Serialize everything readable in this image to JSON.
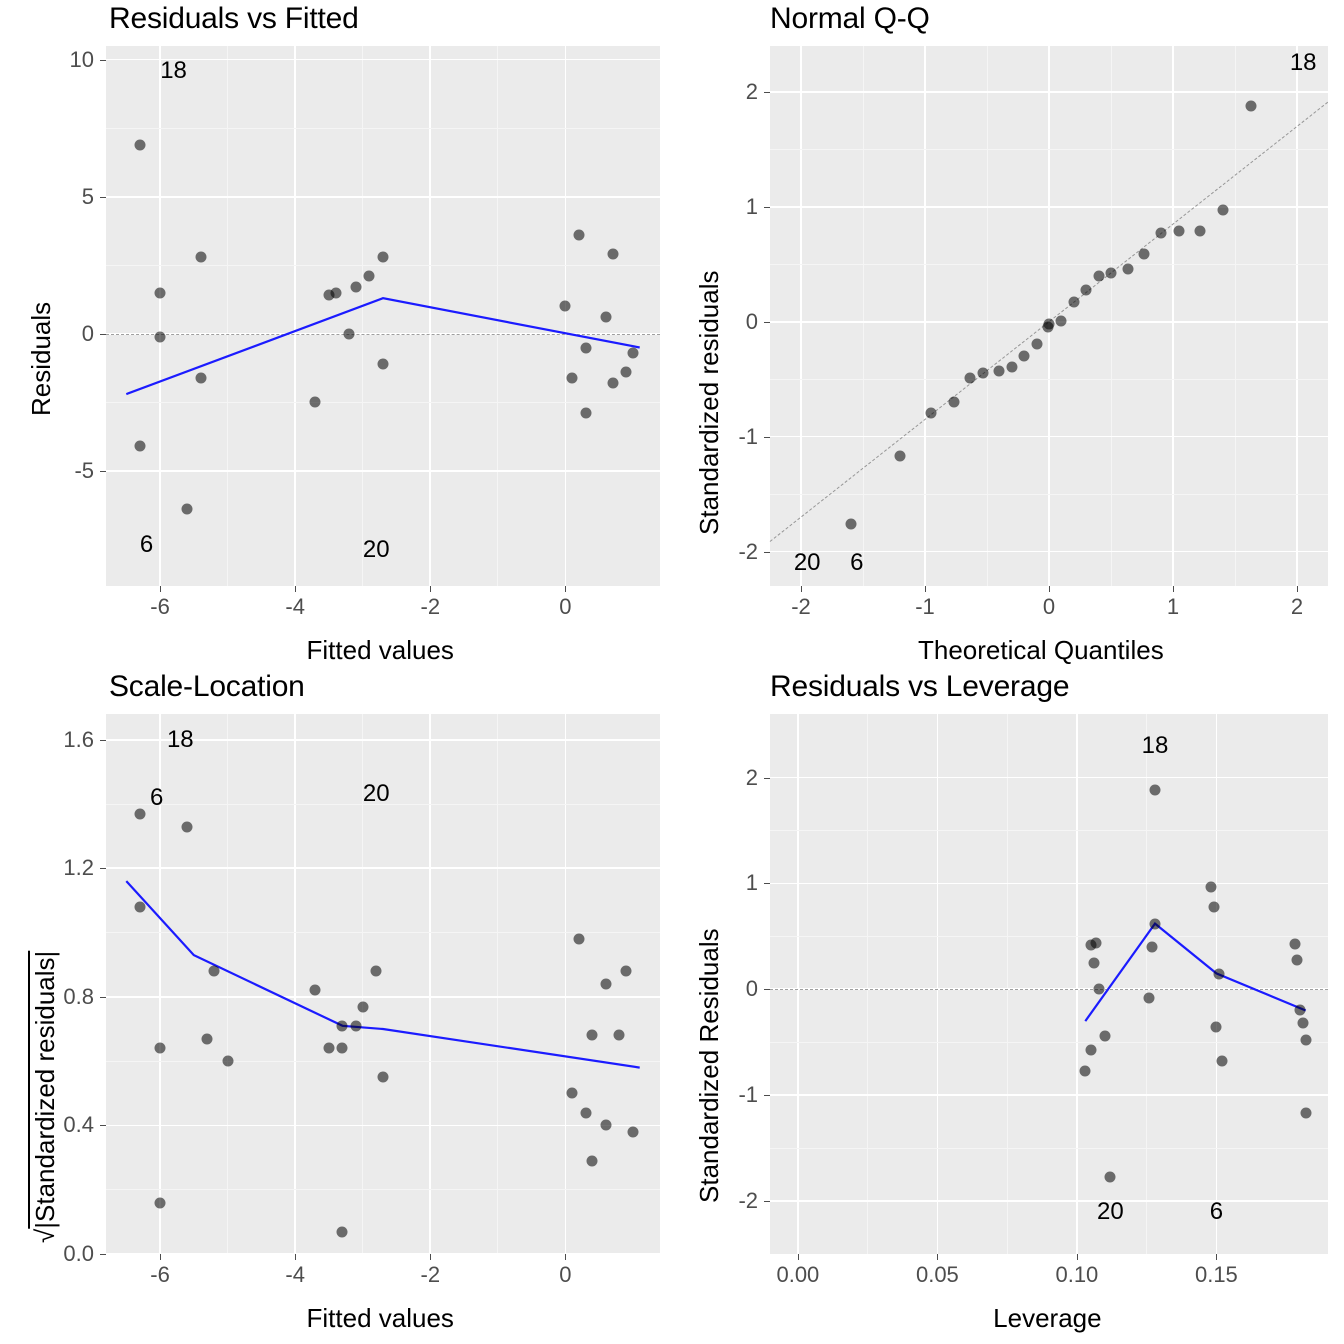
{
  "chart_data": [
    {
      "id": "resid_fitted",
      "type": "scatter",
      "title": "Residuals vs Fitted",
      "xlabel": "Fitted values",
      "ylabel": "Residuals",
      "xlim": [
        -6.8,
        1.4
      ],
      "ylim": [
        -9.2,
        10.5
      ],
      "x_ticks": [
        -6,
        -4,
        -2,
        0
      ],
      "y_ticks": [
        -5,
        0,
        5,
        10
      ],
      "hline": 0,
      "points": [
        {
          "x": -6.3,
          "y": -4.1
        },
        {
          "x": -6.3,
          "y": 6.9
        },
        {
          "x": -6.0,
          "y": -0.1
        },
        {
          "x": -6.0,
          "y": 1.5
        },
        {
          "x": -5.6,
          "y": -6.4
        },
        {
          "x": -5.4,
          "y": -1.6
        },
        {
          "x": -5.4,
          "y": 2.8
        },
        {
          "x": -3.7,
          "y": -2.5
        },
        {
          "x": -3.5,
          "y": 1.4
        },
        {
          "x": -3.4,
          "y": 1.5
        },
        {
          "x": -3.2,
          "y": 0.0
        },
        {
          "x": -3.1,
          "y": 1.7
        },
        {
          "x": -2.9,
          "y": 2.1
        },
        {
          "x": -2.7,
          "y": 2.8
        },
        {
          "x": -2.7,
          "y": -1.1
        },
        {
          "x": 0.0,
          "y": 1.0
        },
        {
          "x": 0.1,
          "y": -1.6
        },
        {
          "x": 0.2,
          "y": 3.6
        },
        {
          "x": 0.3,
          "y": -0.5
        },
        {
          "x": 0.3,
          "y": -2.9
        },
        {
          "x": 0.6,
          "y": 0.6
        },
        {
          "x": 0.7,
          "y": -1.8
        },
        {
          "x": 0.7,
          "y": 2.9
        },
        {
          "x": 0.9,
          "y": -1.4
        },
        {
          "x": 1.0,
          "y": -0.7
        }
      ],
      "smooth": [
        {
          "x": -6.5,
          "y": -2.2
        },
        {
          "x": -2.7,
          "y": 1.3
        },
        {
          "x": 1.1,
          "y": -0.5
        }
      ],
      "annotations": [
        {
          "x": -5.8,
          "y": 9.6,
          "text": "18"
        },
        {
          "x": -6.2,
          "y": -7.7,
          "text": "6"
        },
        {
          "x": -2.8,
          "y": -7.9,
          "text": "20"
        }
      ]
    },
    {
      "id": "qq",
      "type": "scatter",
      "title": "Normal Q-Q",
      "xlabel": "Theoretical Quantiles",
      "ylabel": "Standardized residuals",
      "xlim": [
        -2.25,
        2.25
      ],
      "ylim": [
        -2.3,
        2.4
      ],
      "x_ticks": [
        -2,
        -1,
        0,
        1,
        2
      ],
      "y_ticks": [
        -2,
        -1,
        0,
        1,
        2
      ],
      "refline": {
        "slope": 0.85,
        "intercept": 0.0
      },
      "points": [
        {
          "x": -1.6,
          "y": -1.76
        },
        {
          "x": -1.2,
          "y": -1.17
        },
        {
          "x": -0.95,
          "y": -0.79
        },
        {
          "x": -0.77,
          "y": -0.7
        },
        {
          "x": -0.64,
          "y": -0.49
        },
        {
          "x": -0.53,
          "y": -0.45
        },
        {
          "x": -0.4,
          "y": -0.43
        },
        {
          "x": -0.3,
          "y": -0.39
        },
        {
          "x": -0.2,
          "y": -0.3
        },
        {
          "x": -0.1,
          "y": -0.19
        },
        {
          "x": -0.01,
          "y": -0.05
        },
        {
          "x": 0.0,
          "y": -0.02
        },
        {
          "x": 0.1,
          "y": 0.01
        },
        {
          "x": 0.2,
          "y": 0.17
        },
        {
          "x": 0.3,
          "y": 0.28
        },
        {
          "x": 0.4,
          "y": 0.4
        },
        {
          "x": 0.5,
          "y": 0.42
        },
        {
          "x": 0.64,
          "y": 0.46
        },
        {
          "x": 0.77,
          "y": 0.59
        },
        {
          "x": 0.9,
          "y": 0.77
        },
        {
          "x": 1.05,
          "y": 0.79
        },
        {
          "x": 1.22,
          "y": 0.79
        },
        {
          "x": 1.4,
          "y": 0.97
        },
        {
          "x": 1.63,
          "y": 1.88
        }
      ],
      "annotations": [
        {
          "x": 2.05,
          "y": 2.25,
          "text": "18"
        },
        {
          "x": -1.95,
          "y": -2.1,
          "text": "20"
        },
        {
          "x": -1.55,
          "y": -2.1,
          "text": "6"
        }
      ]
    },
    {
      "id": "scale_loc",
      "type": "scatter",
      "title": "Scale-Location",
      "xlabel": "Fitted values",
      "ylabel_complex": {
        "prefix": "√",
        "body": "|Standardized residuals|"
      },
      "xlim": [
        -6.8,
        1.4
      ],
      "ylim": [
        0.0,
        1.68
      ],
      "x_ticks": [
        -6,
        -4,
        -2,
        0
      ],
      "y_ticks": [
        0.0,
        0.4,
        0.8,
        1.2,
        1.6
      ],
      "points": [
        {
          "x": -6.3,
          "y": 1.08
        },
        {
          "x": -6.3,
          "y": 1.37
        },
        {
          "x": -6.0,
          "y": 0.16
        },
        {
          "x": -6.0,
          "y": 0.64
        },
        {
          "x": -5.6,
          "y": 1.33
        },
        {
          "x": -5.3,
          "y": 0.67
        },
        {
          "x": -5.2,
          "y": 0.88
        },
        {
          "x": -5.0,
          "y": 0.6
        },
        {
          "x": -3.7,
          "y": 0.82
        },
        {
          "x": -3.5,
          "y": 0.64
        },
        {
          "x": -3.3,
          "y": 0.07
        },
        {
          "x": -3.3,
          "y": 0.64
        },
        {
          "x": -3.3,
          "y": 0.71
        },
        {
          "x": -3.1,
          "y": 0.71
        },
        {
          "x": -3.0,
          "y": 0.77
        },
        {
          "x": -2.8,
          "y": 0.88
        },
        {
          "x": -2.7,
          "y": 0.55
        },
        {
          "x": 0.1,
          "y": 0.5
        },
        {
          "x": 0.2,
          "y": 0.98
        },
        {
          "x": 0.3,
          "y": 0.44
        },
        {
          "x": 0.4,
          "y": 0.68
        },
        {
          "x": 0.4,
          "y": 0.29
        },
        {
          "x": 0.6,
          "y": 0.84
        },
        {
          "x": 0.6,
          "y": 0.4
        },
        {
          "x": 0.8,
          "y": 0.68
        },
        {
          "x": 0.9,
          "y": 0.88
        },
        {
          "x": 1.0,
          "y": 0.38
        }
      ],
      "smooth": [
        {
          "x": -6.5,
          "y": 1.16
        },
        {
          "x": -5.5,
          "y": 0.93
        },
        {
          "x": -3.3,
          "y": 0.71
        },
        {
          "x": -2.7,
          "y": 0.7
        },
        {
          "x": 1.1,
          "y": 0.58
        }
      ],
      "annotations": [
        {
          "x": -5.7,
          "y": 1.6,
          "text": "18"
        },
        {
          "x": -6.05,
          "y": 1.42,
          "text": "6"
        },
        {
          "x": -2.8,
          "y": 1.43,
          "text": "20"
        }
      ]
    },
    {
      "id": "resid_lev",
      "type": "scatter",
      "title": "Residuals vs Leverage",
      "xlabel": "Leverage",
      "ylabel": "Standardized Residuals",
      "xlim": [
        -0.01,
        0.19
      ],
      "ylim": [
        -2.5,
        2.6
      ],
      "x_ticks": [
        0.0,
        0.05,
        0.1,
        0.15
      ],
      "y_ticks": [
        -2,
        -1,
        0,
        1,
        2
      ],
      "hline": 0,
      "points": [
        {
          "x": 0.103,
          "y": -0.77
        },
        {
          "x": 0.105,
          "y": -0.57
        },
        {
          "x": 0.105,
          "y": 0.42
        },
        {
          "x": 0.106,
          "y": 0.25
        },
        {
          "x": 0.107,
          "y": 0.44
        },
        {
          "x": 0.108,
          "y": 0.0
        },
        {
          "x": 0.11,
          "y": -0.44
        },
        {
          "x": 0.112,
          "y": -1.77
        },
        {
          "x": 0.126,
          "y": -0.08
        },
        {
          "x": 0.127,
          "y": 0.4
        },
        {
          "x": 0.128,
          "y": 0.62
        },
        {
          "x": 0.128,
          "y": 1.88
        },
        {
          "x": 0.148,
          "y": 0.97
        },
        {
          "x": 0.149,
          "y": 0.78
        },
        {
          "x": 0.15,
          "y": -0.36
        },
        {
          "x": 0.151,
          "y": 0.14
        },
        {
          "x": 0.152,
          "y": -0.68
        },
        {
          "x": 0.178,
          "y": 0.43
        },
        {
          "x": 0.179,
          "y": 0.28
        },
        {
          "x": 0.18,
          "y": -0.2
        },
        {
          "x": 0.181,
          "y": -0.32
        },
        {
          "x": 0.182,
          "y": -0.48
        },
        {
          "x": 0.182,
          "y": -1.17
        }
      ],
      "smooth": [
        {
          "x": 0.103,
          "y": -0.3
        },
        {
          "x": 0.128,
          "y": 0.62
        },
        {
          "x": 0.15,
          "y": 0.15
        },
        {
          "x": 0.182,
          "y": -0.2
        }
      ],
      "annotations": [
        {
          "x": 0.128,
          "y": 2.3,
          "text": "18"
        },
        {
          "x": 0.112,
          "y": -2.1,
          "text": "20"
        },
        {
          "x": 0.15,
          "y": -2.1,
          "text": "6"
        }
      ]
    }
  ]
}
